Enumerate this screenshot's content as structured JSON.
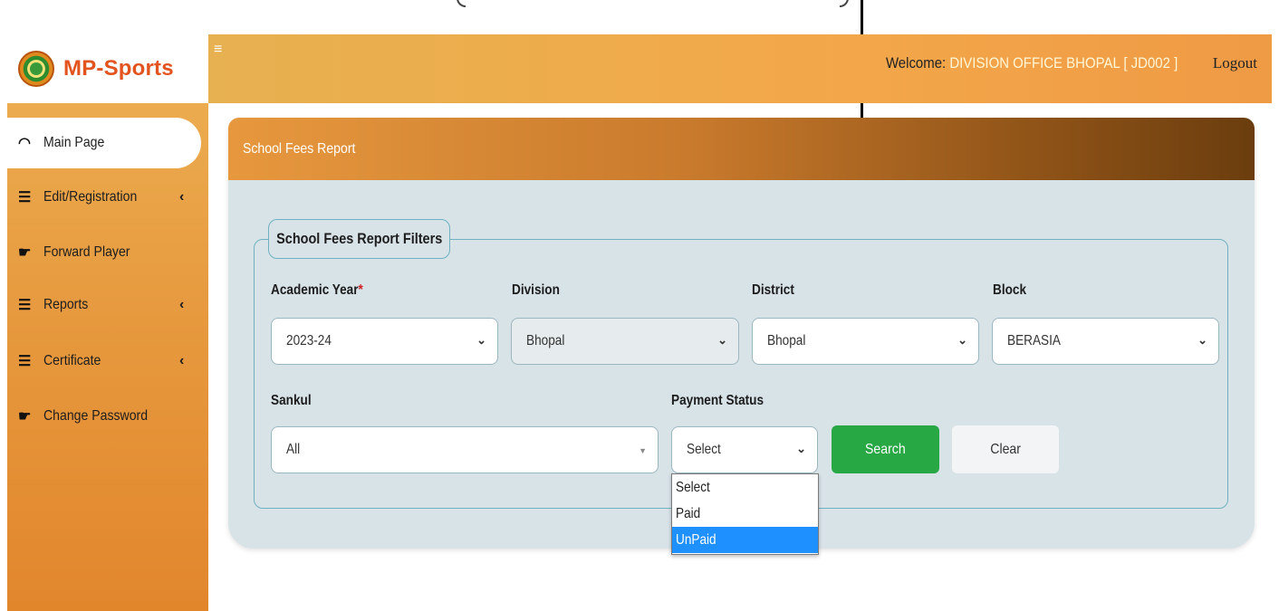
{
  "header": {
    "logo_text": "MP-Sports",
    "hamburger": "≡",
    "welcome_prefix": "Welcome: ",
    "welcome_name": "DIVISION OFFICE BHOPAL [ JD002 ]",
    "logout_label": "Logout"
  },
  "sidebar": {
    "items": [
      {
        "label": "Main Page",
        "icon": "gauge-icon",
        "active": true
      },
      {
        "label": "Edit/Registration",
        "icon": "list-icon",
        "has_submenu": true
      },
      {
        "label": "Forward Player",
        "icon": "hand-point-icon"
      },
      {
        "label": "Reports",
        "icon": "list-icon",
        "has_submenu": true
      },
      {
        "label": "Certificate",
        "icon": "list-icon",
        "has_submenu": true
      },
      {
        "label": "Change Password",
        "icon": "hand-point-icon"
      }
    ]
  },
  "card": {
    "title": "School Fees Report",
    "filters_legend": "School Fees Report Filters"
  },
  "filters": {
    "academic_year": {
      "label": "Academic Year",
      "required_mark": "*",
      "value": "2023-24"
    },
    "division": {
      "label": "Division",
      "value": "Bhopal",
      "disabled": true
    },
    "district": {
      "label": "District",
      "value": "Bhopal"
    },
    "block": {
      "label": "Block",
      "value": "BERASIA"
    },
    "sankul": {
      "label": "Sankul",
      "value": "All"
    },
    "payment_status": {
      "label": "Payment Status",
      "value": "Select",
      "options": [
        "Select",
        "Paid",
        "UnPaid"
      ],
      "highlighted": "UnPaid"
    }
  },
  "buttons": {
    "search_label": "Search",
    "clear_label": "Clear"
  },
  "colors": {
    "brand_orange": "#e2531d",
    "search_green": "#28a745",
    "highlight_blue": "#1e90ff"
  }
}
